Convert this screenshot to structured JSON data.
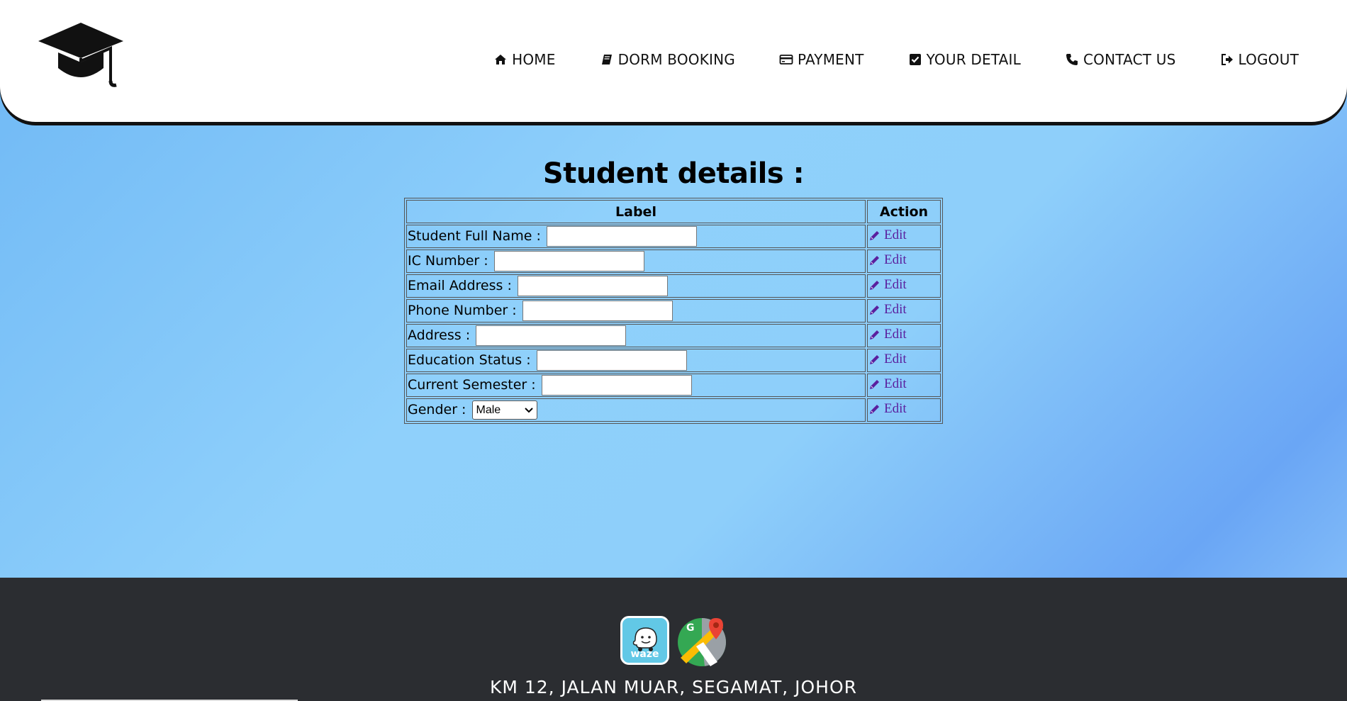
{
  "nav": {
    "items": [
      {
        "label": "HOME",
        "icon": "home-icon"
      },
      {
        "label": "DORM BOOKING",
        "icon": "book-icon"
      },
      {
        "label": "PAYMENT",
        "icon": "credit-card-icon"
      },
      {
        "label": "YOUR DETAIL",
        "icon": "check-square-icon"
      },
      {
        "label": "CONTACT US",
        "icon": "phone-icon"
      },
      {
        "label": "LOGOUT",
        "icon": "sign-out-icon"
      }
    ]
  },
  "main": {
    "title": "Student details :",
    "table": {
      "headers": {
        "label": "Label",
        "action": "Action"
      },
      "rows": [
        {
          "label": "Student Full Name :",
          "value": "",
          "action": "Edit"
        },
        {
          "label": "IC Number :",
          "value": "",
          "action": "Edit"
        },
        {
          "label": "Email Address :",
          "value": "",
          "action": "Edit"
        },
        {
          "label": "Phone Number :",
          "value": "",
          "action": "Edit"
        },
        {
          "label": "Address :",
          "value": "",
          "action": "Edit"
        },
        {
          "label": "Education Status :",
          "value": "",
          "action": "Edit"
        },
        {
          "label": "Current Semester :",
          "value": "",
          "action": "Edit"
        }
      ],
      "gender": {
        "label": "Gender :",
        "selected": "Male",
        "action": "Edit"
      }
    }
  },
  "footer": {
    "waze_label": "waze",
    "gmaps_letter": "G",
    "address": "KM 12, JALAN MUAR, SEGAMAT, JOHOR"
  },
  "colors": {
    "header_bg": "#ffffff",
    "footer_bg": "#2b2d31",
    "link": "#5a1f9e",
    "waze": "#62c8e6"
  }
}
